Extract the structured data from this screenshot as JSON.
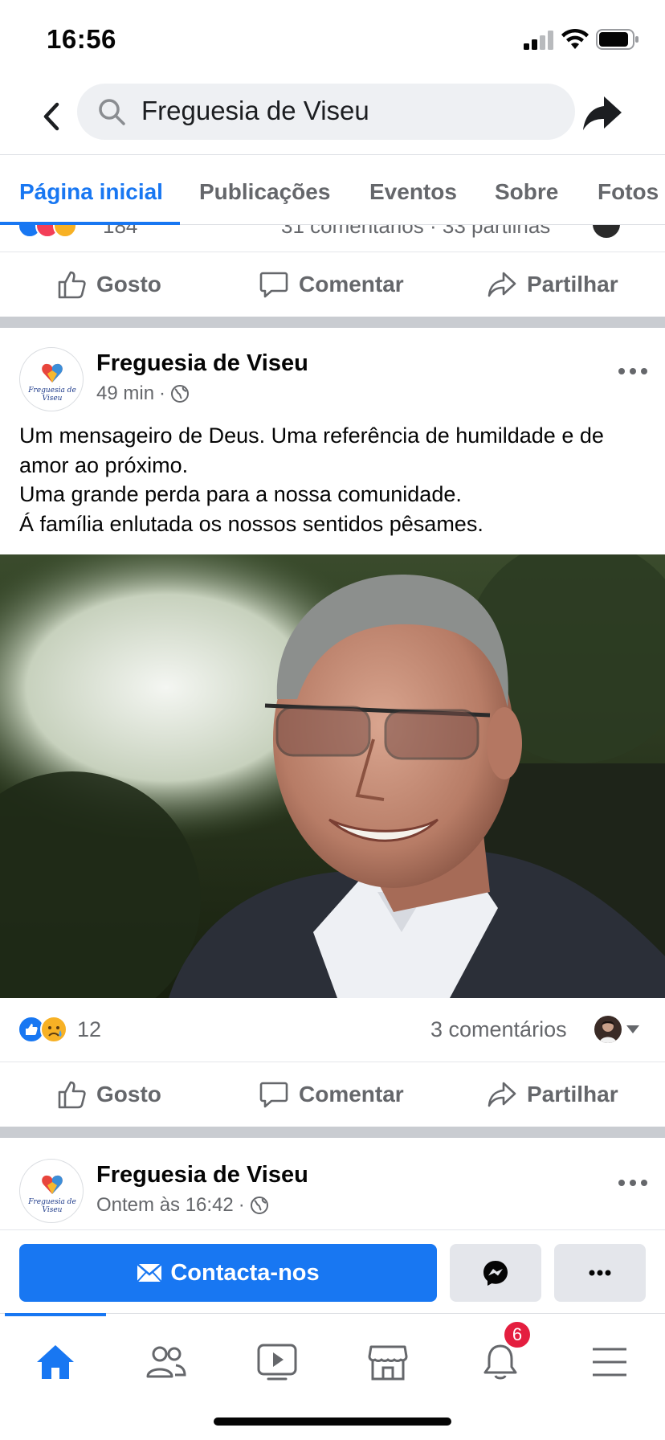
{
  "status_bar": {
    "time": "16:56"
  },
  "header": {
    "search_text": "Freguesia de Viseu"
  },
  "tabs": [
    {
      "label": "Página inicial",
      "active": true
    },
    {
      "label": "Publicações"
    },
    {
      "label": "Eventos"
    },
    {
      "label": "Sobre"
    },
    {
      "label": "Fotos"
    }
  ],
  "previous_post": {
    "reaction_count": "184",
    "stats": "31 comentários · 33 partilhas"
  },
  "actions": {
    "like": "Gosto",
    "comment": "Comentar",
    "share": "Partilhar"
  },
  "post": {
    "page_name": "Freguesia de Viseu",
    "avatar_text": "Freguesia de Viseu",
    "time": "49 min",
    "text_lines": [
      "Um mensageiro de Deus. Uma referência de humildade e de",
      "amor ao próximo.",
      "Uma grande perda para a nossa comunidade.",
      "Á família enlutada os nossos sentidos pêsames."
    ],
    "reaction_count": "12",
    "comments": "3 comentários"
  },
  "next_post": {
    "page_name": "Freguesia de Viseu",
    "time": "Ontem às 16:42"
  },
  "contact_bar": {
    "contact_label": "Contacta-nos"
  },
  "bottom_nav": {
    "notification_badge": "6"
  },
  "colors": {
    "accent": "#1877f2",
    "text": "#050505",
    "secondary": "#65676b",
    "badge": "#e41e3f"
  }
}
